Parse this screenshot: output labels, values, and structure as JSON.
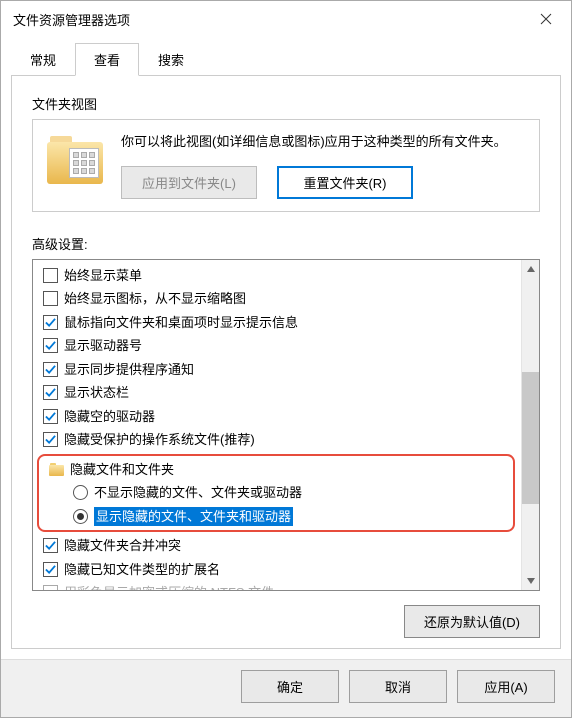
{
  "window": {
    "title": "文件资源管理器选项"
  },
  "tabs": {
    "general": "常规",
    "view": "查看",
    "search": "搜索"
  },
  "folderView": {
    "heading": "文件夹视图",
    "description": "你可以将此视图(如详细信息或图标)应用于这种类型的所有文件夹。",
    "applyBtn": "应用到文件夹(L)",
    "resetBtn": "重置文件夹(R)"
  },
  "advanced": {
    "heading": "高级设置:",
    "items": [
      {
        "type": "checkbox",
        "checked": false,
        "label": "始终显示菜单"
      },
      {
        "type": "checkbox",
        "checked": false,
        "label": "始终显示图标，从不显示缩略图"
      },
      {
        "type": "checkbox",
        "checked": true,
        "label": "鼠标指向文件夹和桌面项时显示提示信息"
      },
      {
        "type": "checkbox",
        "checked": true,
        "label": "显示驱动器号"
      },
      {
        "type": "checkbox",
        "checked": true,
        "label": "显示同步提供程序通知"
      },
      {
        "type": "checkbox",
        "checked": true,
        "label": "显示状态栏"
      },
      {
        "type": "checkbox",
        "checked": true,
        "label": "隐藏空的驱动器"
      },
      {
        "type": "checkbox",
        "checked": true,
        "label": "隐藏受保护的操作系统文件(推荐)"
      },
      {
        "type": "header",
        "label": "隐藏文件和文件夹"
      },
      {
        "type": "radio",
        "checked": false,
        "label": "不显示隐藏的文件、文件夹或驱动器"
      },
      {
        "type": "radio",
        "checked": true,
        "selected": true,
        "label": "显示隐藏的文件、文件夹和驱动器"
      },
      {
        "type": "checkbox",
        "checked": true,
        "label": "隐藏文件夹合并冲突"
      },
      {
        "type": "checkbox",
        "checked": true,
        "label": "隐藏已知文件类型的扩展名"
      },
      {
        "type": "checkbox",
        "checked": false,
        "cutoff": true,
        "label": "用彩色显示加密或压缩的 NTFS 文件"
      }
    ],
    "restoreBtn": "还原为默认值(D)"
  },
  "footer": {
    "ok": "确定",
    "cancel": "取消",
    "apply": "应用(A)"
  }
}
